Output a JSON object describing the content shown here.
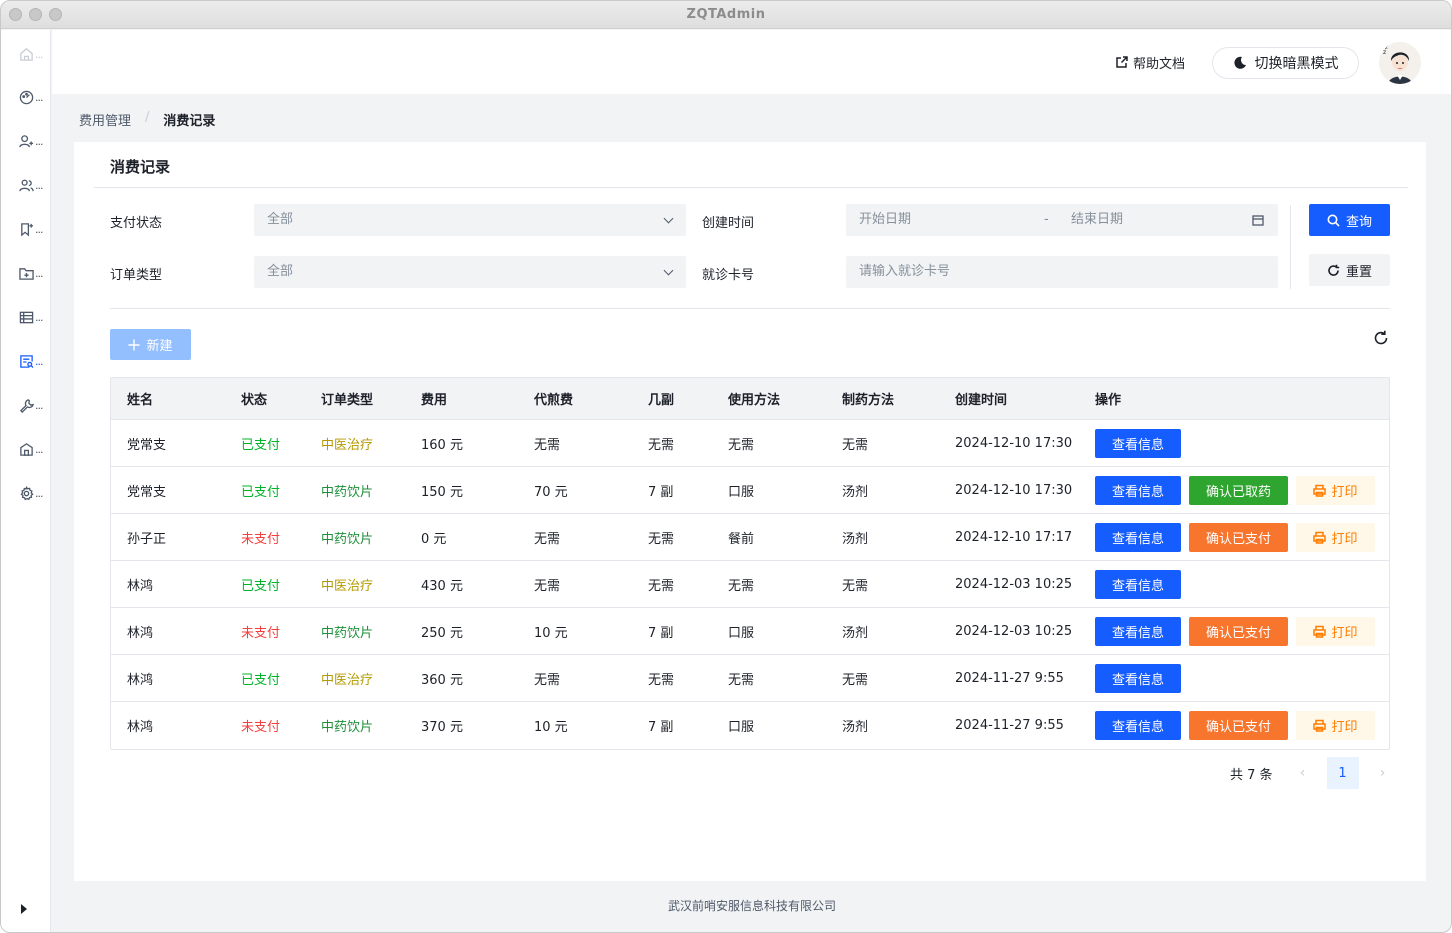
{
  "window": {
    "title": "ZQTAdmin"
  },
  "sidebar": {
    "items": [
      {
        "icon": "home-icon",
        "label": "..."
      },
      {
        "icon": "dashboard-icon",
        "label": "..."
      },
      {
        "icon": "user-add-icon",
        "label": "..."
      },
      {
        "icon": "user-group-icon",
        "label": "..."
      },
      {
        "icon": "bookmark-icon",
        "label": "..."
      },
      {
        "icon": "folder-add-icon",
        "label": "..."
      },
      {
        "icon": "list-icon",
        "label": "..."
      },
      {
        "icon": "record-icon",
        "label": "..."
      },
      {
        "icon": "tool-icon",
        "label": "..."
      },
      {
        "icon": "building-icon",
        "label": "..."
      },
      {
        "icon": "settings-icon",
        "label": "..."
      }
    ]
  },
  "header": {
    "help": "帮助文档",
    "dark_mode": "切换暗黑模式"
  },
  "breadcrumb": {
    "parent": "费用管理",
    "sep": "/",
    "current": "消费记录"
  },
  "card": {
    "title": "消费记录"
  },
  "filters": {
    "pay_status": {
      "label": "支付状态",
      "value": "全部"
    },
    "order_type": {
      "label": "订单类型",
      "value": "全部"
    },
    "create_time": {
      "label": "创建时间",
      "start": "开始日期",
      "dash": "-",
      "end": "结束日期"
    },
    "card_no": {
      "label": "就诊卡号",
      "placeholder": "请输入就诊卡号"
    },
    "query": "查询",
    "reset": "重置"
  },
  "toolbar": {
    "new": "新建"
  },
  "table": {
    "headers": [
      "姓名",
      "状态",
      "订单类型",
      "费用",
      "代煎费",
      "几副",
      "使用方法",
      "制药方法",
      "创建时间",
      "操作"
    ],
    "actions": {
      "view": "查看信息",
      "confirm_taken": "确认已取药",
      "confirm_paid": "确认已支付",
      "print": "打印"
    },
    "rows": [
      {
        "name": "党常支",
        "status": "已支付",
        "type": "中医治疗",
        "fee": "160 元",
        "decoct": "无需",
        "doses": "无需",
        "usage": "无需",
        "method": "无需",
        "time": "2024-12-10 17:30"
      },
      {
        "name": "党常支",
        "status": "已支付",
        "type": "中药饮片",
        "fee": "150 元",
        "decoct": "70 元",
        "doses": "7 副",
        "usage": "口服",
        "method": "汤剂",
        "time": "2024-12-10 17:30"
      },
      {
        "name": "孙子正",
        "status": "未支付",
        "type": "中药饮片",
        "fee": "0 元",
        "decoct": "无需",
        "doses": "无需",
        "usage": "餐前",
        "method": "汤剂",
        "time": "2024-12-10 17:17"
      },
      {
        "name": "林鸿",
        "status": "已支付",
        "type": "中医治疗",
        "fee": "430 元",
        "decoct": "无需",
        "doses": "无需",
        "usage": "无需",
        "method": "无需",
        "time": "2024-12-03 10:25"
      },
      {
        "name": "林鸿",
        "status": "未支付",
        "type": "中药饮片",
        "fee": "250 元",
        "decoct": "10 元",
        "doses": "7 副",
        "usage": "口服",
        "method": "汤剂",
        "time": "2024-12-03 10:25"
      },
      {
        "name": "林鸿",
        "status": "已支付",
        "type": "中医治疗",
        "fee": "360 元",
        "decoct": "无需",
        "doses": "无需",
        "usage": "无需",
        "method": "无需",
        "time": "2024-11-27 9:55"
      },
      {
        "name": "林鸿",
        "status": "未支付",
        "type": "中药饮片",
        "fee": "370 元",
        "decoct": "10 元",
        "doses": "7 副",
        "usage": "口服",
        "method": "汤剂",
        "time": "2024-11-27 9:55"
      }
    ]
  },
  "pagination": {
    "total": "共 7 条",
    "current": "1"
  },
  "footer": {
    "text": "武汉前哨安服信息科技有限公司"
  },
  "colors": {
    "primary": "#165dff",
    "paid": "#00b42a",
    "unpaid": "#f53f3f",
    "treatment": "#b39a00",
    "herbal": "#1f8f3a",
    "confirm_taken": "#2ea52e",
    "confirm_paid": "#f7752c",
    "print": "#ff7d00"
  }
}
